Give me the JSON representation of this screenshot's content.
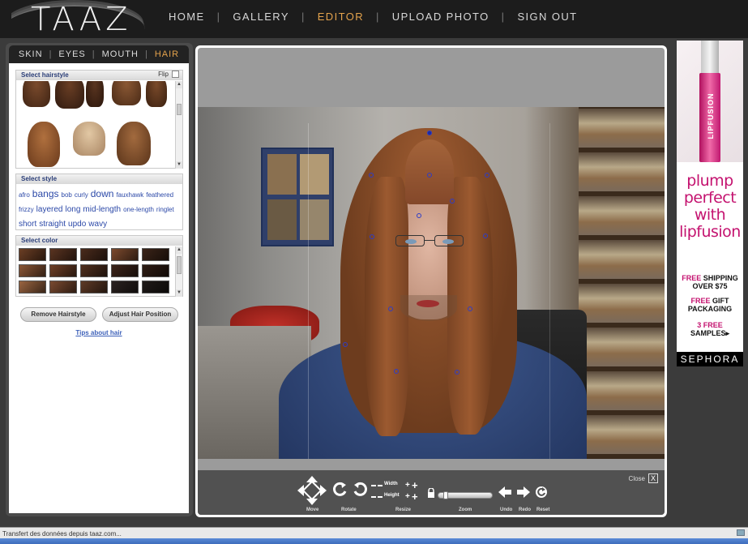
{
  "header": {
    "logo": "TAAZ",
    "nav": [
      {
        "label": "HOME",
        "active": false
      },
      {
        "label": "GALLERY",
        "active": false
      },
      {
        "label": "EDITOR",
        "active": true
      },
      {
        "label": "UPLOAD PHOTO",
        "active": false
      },
      {
        "label": "SIGN OUT",
        "active": false
      }
    ]
  },
  "panel": {
    "tabs": [
      {
        "label": "SKIN",
        "active": false
      },
      {
        "label": "EYES",
        "active": false
      },
      {
        "label": "MOUTH",
        "active": false
      },
      {
        "label": "HAIR",
        "active": true
      }
    ],
    "hairstyle_title": "Select hairstyle",
    "flip_label": "Flip",
    "style_title": "Select style",
    "styles": [
      {
        "word": "afro",
        "size": "small"
      },
      {
        "word": "bangs",
        "size": "large"
      },
      {
        "word": "bob",
        "size": "small"
      },
      {
        "word": "curly",
        "size": "small"
      },
      {
        "word": "down",
        "size": "large"
      },
      {
        "word": "fauxhawk",
        "size": "small"
      },
      {
        "word": "feathered",
        "size": "small"
      },
      {
        "word": "frizzy",
        "size": "small"
      },
      {
        "word": "layered",
        "size": "medium"
      },
      {
        "word": "long",
        "size": "medium"
      },
      {
        "word": "mid-length",
        "size": "medium"
      },
      {
        "word": "one-length",
        "size": "small"
      },
      {
        "word": "ringlet",
        "size": "small"
      },
      {
        "word": "short",
        "size": "medium"
      },
      {
        "word": "straight",
        "size": "medium"
      },
      {
        "word": "updo",
        "size": "medium"
      },
      {
        "word": "wavy",
        "size": "medium"
      }
    ],
    "color_title": "Select color",
    "swatch_colors": [
      "#6b3e24",
      "#5a3421",
      "#4a2b1c",
      "#7c4a2e",
      "#3b2418",
      "#8a5636",
      "#6e4028",
      "#50301f",
      "#3c241a",
      "#2e1c14",
      "#9a6440",
      "#7a4a30",
      "#5e3a26",
      "#2a2220",
      "#1f1a18"
    ],
    "remove_button": "Remove Hairstyle",
    "adjust_button": "Adjust Hair Position",
    "tips_link": "Tips about hair"
  },
  "editor": {
    "close_label": "Close",
    "close_glyph": "X",
    "tools": {
      "move": "Move",
      "rotate": "Rotate",
      "resize": "Resize",
      "width_label": "Width",
      "height_label": "Height",
      "zoom": "Zoom",
      "undo": "Undo",
      "redo": "Redo",
      "reset": "Reset"
    }
  },
  "ad": {
    "product_name": "LIPFUSION",
    "headline_1": "plump",
    "headline_2": "perfect",
    "headline_3": "with",
    "headline_4": "lipfusion",
    "offer_1_accent": "FREE",
    "offer_1_rest": "SHIPPING",
    "offer_1_line2": "OVER $75",
    "offer_2_accent": "FREE",
    "offer_2_rest": "GIFT",
    "offer_2_line2": "PACKAGING",
    "offer_3_accent": "3 FREE",
    "offer_3_line2": "SAMPLES",
    "brand": "SEPHORA"
  },
  "status": {
    "text": "Transfert des données depuis taaz.com..."
  },
  "colors": {
    "accent": "#e3a24c",
    "link": "#2c49a8",
    "ad_pink": "#c4126f"
  }
}
